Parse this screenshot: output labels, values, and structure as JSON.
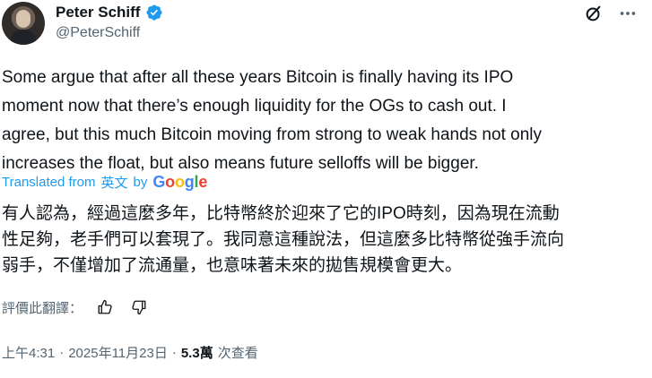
{
  "author": {
    "display_name": "Peter Schiff",
    "handle": "@PeterSchiff"
  },
  "tweet": {
    "text": "Some argue that after all these years Bitcoin is finally having its IPO\nmoment now that there’s enough liquidity for the OGs to cash out. I\nagree, but this much Bitcoin moving from strong to weak hands not only\nincreases the float, but also means future selloffs will be bigger.",
    "translation_prefix": "Translated from",
    "translation_source": "英文",
    "translation_by": "by",
    "translation_provider": "Google",
    "translated_text": "有人認為，經過這麼多年，比特幣終於迎來了它的IPO時刻，因為現在流動\n性足夠，老手們可以套現了。我同意這種說法，但這麼多比特幣從強手流向\n弱手，不僅增加了流通量，也意味著未來的拋售規模會更大。",
    "rate_label": "評價此翻譯：",
    "time": "上午4:31",
    "date": "2025年11月23日",
    "separator": "·",
    "views_count": "5.3萬",
    "views_label": "次查看"
  },
  "icons": {
    "verified": "verified-badge-icon",
    "grok": "grok-icon",
    "more": "more-icon",
    "thumb_up": "thumb-up-icon",
    "thumb_down": "thumb-down-icon"
  },
  "colors": {
    "accent": "#1d9bf0",
    "text": "#0f1419",
    "secondary": "#536471"
  }
}
